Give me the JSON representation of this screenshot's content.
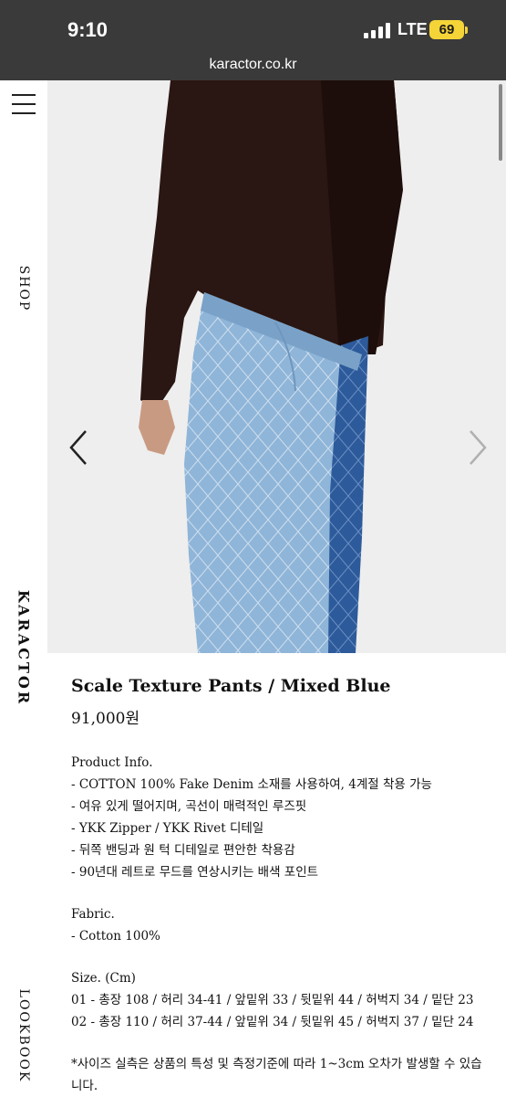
{
  "status_bar": {
    "time": "9:10",
    "network": "LTE",
    "battery": "69"
  },
  "browser": {
    "url": "karactor.co.kr"
  },
  "sidebar": {
    "shop": "SHOP",
    "brand": "KARACTOR",
    "lookbook": "LOOKBOOK"
  },
  "product": {
    "title": "Scale Texture Pants / Mixed Blue",
    "price": "91,000원",
    "info_heading": "Product Info.",
    "info_lines": [
      "- COTTON 100% Fake Denim 소재를 사용하여, 4계절 착용 가능",
      "- 여유 있게 떨어지며, 곡선이 매력적인 루즈핏",
      "- YKK Zipper / YKK Rivet 디테일",
      "- 뒤쪽 밴딩과 원 턱 디테일로 편안한 착용감",
      "- 90년대 레트로 무드를 연상시키는 배색 포인트"
    ],
    "fabric_heading": "Fabric.",
    "fabric_lines": [
      "- Cotton 100%"
    ],
    "size_heading": "Size. (Cm)",
    "size_lines": [
      "01 - 총장 108 / 허리 34-41 / 앞밑위 33 / 뒷밑위 44 / 허벅지 34 / 밑단 23",
      "02 - 총장 110 / 허리 37-44 / 앞밑위 34 / 뒷밑위 45 / 허벅지 37 / 밑단 24"
    ],
    "note": "*사이즈 실측은 상품의 특성 및 측정기준에 따라 1~3cm 오차가 발생할 수 있습니다."
  },
  "icons": {
    "menu": "hamburger-icon",
    "prev": "chevron-left-icon",
    "next": "chevron-right-icon"
  },
  "colors": {
    "status_bg": "#3a3a3a",
    "battery": "#f5d438",
    "photo_bg": "#eeeeee",
    "denim_light": "#8fb5d8",
    "denim_dark": "#2d5a9a",
    "sweater": "#2a1612"
  }
}
